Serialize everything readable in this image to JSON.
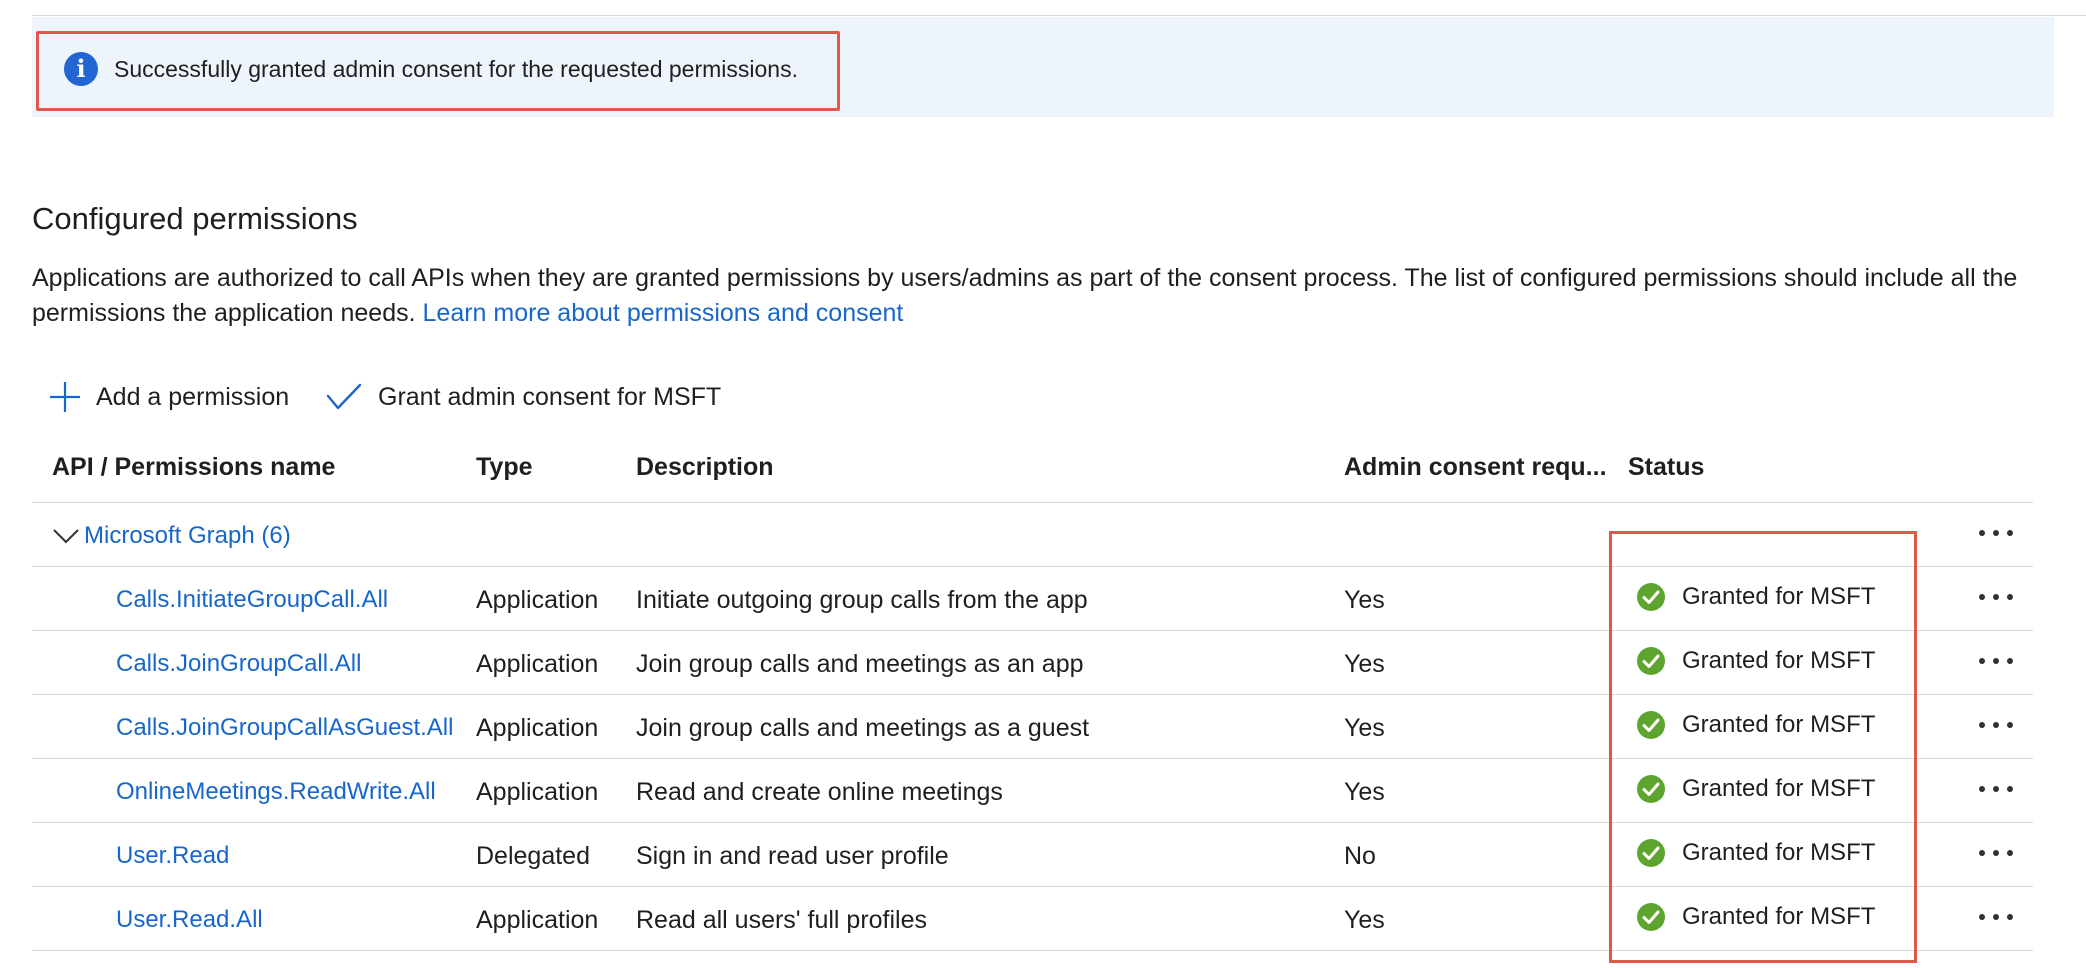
{
  "banner": {
    "icon": "info-icon",
    "icon_glyph": "i",
    "message": "Successfully granted admin consent for the requested permissions.",
    "highlight_color": "#e2574c",
    "background_color": "#eef4fc"
  },
  "section": {
    "title": "Configured permissions",
    "description": "Applications are authorized to call APIs when they are granted permissions by users/admins as part of the consent process. The list of configured permissions should include all the permissions the application needs.",
    "learn_more_link": "Learn more about permissions and consent"
  },
  "toolbar": {
    "add_permission": {
      "label": "Add a permission",
      "icon": "plus-icon"
    },
    "grant_consent": {
      "label": "Grant admin consent for MSFT",
      "icon": "checkmark-icon"
    }
  },
  "table": {
    "columns": [
      "API / Permissions name",
      "Type",
      "Description",
      "Admin consent requ...",
      "Status"
    ],
    "group": {
      "label": "Microsoft Graph (6)",
      "expanded": true,
      "icon": "chevron-down-icon"
    },
    "more_icon": "more-options-icon",
    "rows": [
      {
        "name": "Calls.InitiateGroupCall.All",
        "type": "Application",
        "description": "Initiate outgoing group calls from the app",
        "admin_consent": "Yes",
        "status": "Granted for MSFT"
      },
      {
        "name": "Calls.JoinGroupCall.All",
        "type": "Application",
        "description": "Join group calls and meetings as an app",
        "admin_consent": "Yes",
        "status": "Granted for MSFT"
      },
      {
        "name": "Calls.JoinGroupCallAsGuest.All",
        "type": "Application",
        "description": "Join group calls and meetings as a guest",
        "admin_consent": "Yes",
        "status": "Granted for MSFT"
      },
      {
        "name": "OnlineMeetings.ReadWrite.All",
        "type": "Application",
        "description": "Read and create online meetings",
        "admin_consent": "Yes",
        "status": "Granted for MSFT"
      },
      {
        "name": "User.Read",
        "type": "Delegated",
        "description": "Sign in and read user profile",
        "admin_consent": "No",
        "status": "Granted for MSFT"
      },
      {
        "name": "User.Read.All",
        "type": "Application",
        "description": "Read all users' full profiles",
        "admin_consent": "Yes",
        "status": "Granted for MSFT"
      }
    ],
    "status_icon": "success-check-icon",
    "status_color": "#5ea52f",
    "link_color": "#1866c9"
  }
}
